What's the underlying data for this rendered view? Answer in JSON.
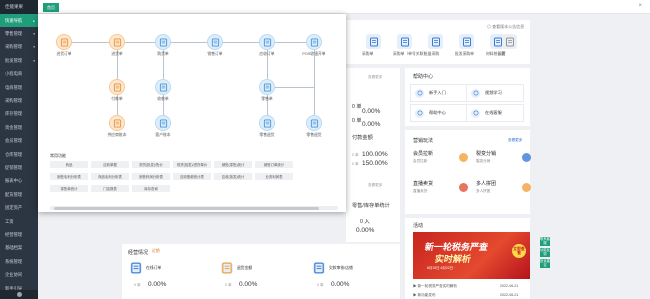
{
  "sidebar": {
    "top_label": "佳能果果",
    "items": [
      {
        "label": "快速导航",
        "caret": "▸",
        "active": true
      },
      {
        "label": "零售管理",
        "caret": "▾"
      },
      {
        "label": "采购管理",
        "caret": "▾"
      },
      {
        "label": "批发管理",
        "caret": "▾"
      },
      {
        "label": "小程电商",
        "caret": ""
      },
      {
        "label": "电商管理",
        "caret": ""
      },
      {
        "label": "采购管理",
        "caret": ""
      },
      {
        "label": "库存管理",
        "caret": ""
      },
      {
        "label": "资金管理",
        "caret": ""
      },
      {
        "label": "会员管理",
        "caret": ""
      },
      {
        "label": "仓库管理",
        "caret": ""
      },
      {
        "label": "促销管理",
        "caret": ""
      },
      {
        "label": "报表中心",
        "caret": ""
      },
      {
        "label": "配货管理",
        "caret": ""
      },
      {
        "label": "固定资产",
        "caret": ""
      },
      {
        "label": "工资",
        "caret": ""
      },
      {
        "label": "经营管理",
        "caret": ""
      },
      {
        "label": "基础档案",
        "caret": ""
      },
      {
        "label": "系统管理",
        "caret": ""
      },
      {
        "label": "企业协同",
        "caret": ""
      },
      {
        "label": "新手引导",
        "caret": ""
      }
    ]
  },
  "topbar": {
    "tab_label": "首页",
    "close": "×"
  },
  "quick": {
    "notice": "◎ 查看版本公告信息",
    "items": [
      {
        "label": "采购单",
        "color": "#3b7bd6"
      },
      {
        "label": "采购单（单号关联）",
        "color": "#3b7bd6"
      },
      {
        "label": "批量采购",
        "color": "#3b7bd6"
      },
      {
        "label": "批发采购单",
        "color": "#3b7bd6"
      },
      {
        "label": "材料统计表",
        "color": "#3b7bd6"
      },
      {
        "label": "设置",
        "color": "#8b96a3"
      }
    ]
  },
  "stats": {
    "pct1": "0.00%",
    "pct2": "0.00%",
    "pct3": "0.00%",
    "amount_title": "付款金额",
    "amount_link": "查看更多",
    "row_a_label": "0 单",
    "row_a_value": "100.00%",
    "row_b_label": "0 单",
    "row_b_value": "150.00%",
    "count_a": "0 单",
    "count_b": "0 入",
    "pct4": "0.00%",
    "wait_title": "库存预警",
    "wait_link": "查看全部",
    "view_a": "查看更多",
    "section_mid": "零售/库存单统计"
  },
  "help": {
    "title": "帮助中心",
    "link": "查看更多",
    "cards": [
      {
        "label": "新手入门",
        "color": "#3b7bd6"
      },
      {
        "label": "视频学习",
        "color": "#3b7bd6"
      },
      {
        "label": "帮助中心",
        "color": "#3b7bd6"
      },
      {
        "label": "在线客服",
        "color": "#3b7bd6"
      }
    ]
  },
  "promo": {
    "title": "营销玩法",
    "link": "查看更多",
    "items": [
      {
        "title": "会员拉新",
        "sub": "会员拉新",
        "color": "#f2a03d"
      },
      {
        "title": "裂变分销",
        "sub": "裂变分销",
        "color": "#3b7bd6"
      },
      {
        "title": "直播卖货",
        "sub": "直播卖货",
        "color": "#e0533b"
      },
      {
        "title": "多人拼团",
        "sub": "多人拼团",
        "color": "#f2a03d"
      }
    ]
  },
  "news": {
    "title": "活动",
    "banner_line1": "新一轮税务严查",
    "banner_line2": "实时解析",
    "banner_badge": "立即查看",
    "banner_foot": "6月15日-6月22日 ·",
    "items": [
      {
        "text": "▶ 新一轮税务严查实时解析",
        "date": "2022-06-21"
      },
      {
        "text": "▶ 新功能发布",
        "date": "2022-06-21"
      }
    ]
  },
  "green_tags": [
    "联系客服",
    "功能反馈",
    "投诉建议"
  ],
  "popup": {
    "flow_nodes": [
      {
        "label": "进货订单",
        "kind": "orange"
      },
      {
        "label": "进货单",
        "kind": "orange"
      },
      {
        "label": "购货单",
        "kind": "blue"
      },
      {
        "label": "销售订单",
        "kind": "blue"
      },
      {
        "label": "应收订单",
        "kind": "blue"
      },
      {
        "label": "POS收银开单",
        "kind": "blue"
      },
      {
        "label": "付款单",
        "kind": "orange"
      },
      {
        "label": "收款单",
        "kind": "blue"
      },
      {
        "label": "零售单",
        "kind": "blue"
      },
      {
        "label": "供应商账本",
        "kind": "orange"
      },
      {
        "label": "客户账本",
        "kind": "blue"
      },
      {
        "label": "零售退货",
        "kind": "blue"
      },
      {
        "label": "零售退货",
        "kind": "blue"
      }
    ],
    "common_title": "常用功能",
    "common_buttons": [
      "商品",
      "应收单据",
      "现货(批发)/售价",
      "现货(批发)/进货单价",
      "销售(零售)统计",
      "销售订单统计",
      "销售毛利分析表",
      "商品毛利分析表",
      "销售利润分析表",
      "应收账款统计表",
      "应收(批发)统计",
      "业务利润表",
      "零售单统计",
      "门店报表",
      "库存查询"
    ]
  },
  "business": {
    "title": "经营情况",
    "tag": "近期",
    "items": [
      {
        "label": "在线订单",
        "color": "#3b7bd6"
      },
      {
        "label": "退货金额",
        "color": "#f2a03d"
      },
      {
        "label": "欠款审核/店铺",
        "color": "#3b7bd6"
      }
    ],
    "row_labels": [
      "0 单",
      "0.00%",
      "0 单",
      "0.00%",
      "0 单",
      "0.00%"
    ]
  }
}
